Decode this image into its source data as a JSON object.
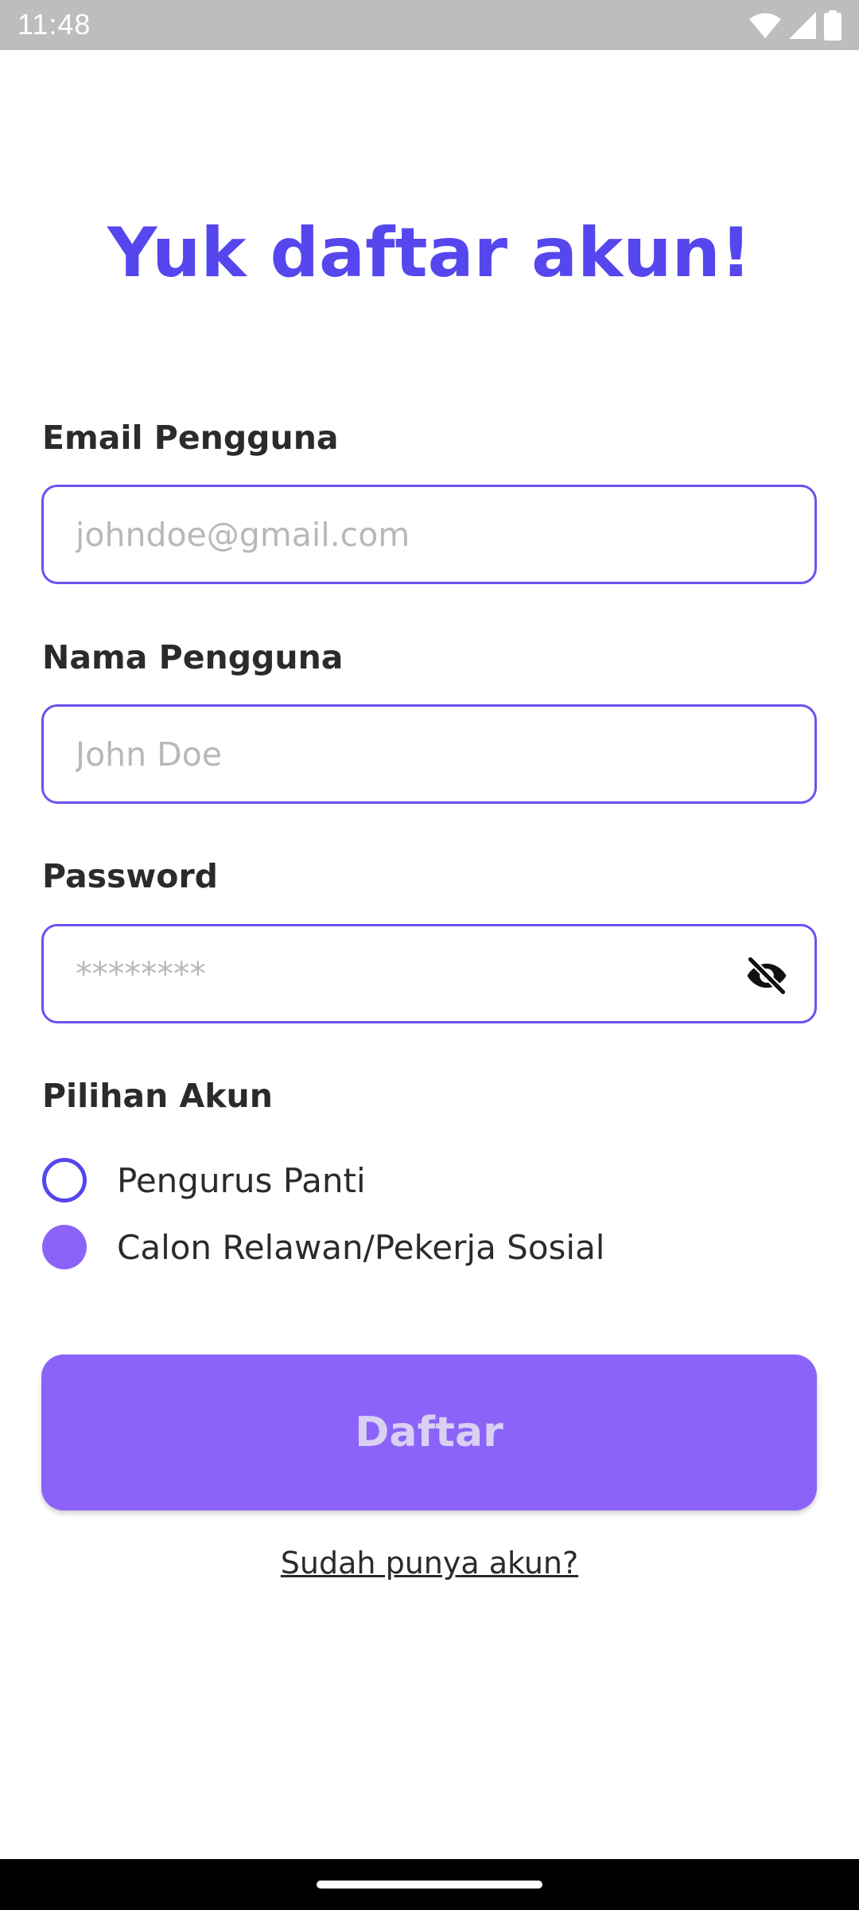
{
  "status_bar": {
    "time": "11:48",
    "icons": [
      "wifi-icon",
      "signal-icon",
      "battery-icon"
    ]
  },
  "title": "Yuk daftar akun!",
  "form": {
    "email": {
      "label": "Email Pengguna",
      "placeholder": "johndoe@gmail.com",
      "value": ""
    },
    "name": {
      "label": "Nama Pengguna",
      "placeholder": "John Doe",
      "value": ""
    },
    "password": {
      "label": "Password",
      "placeholder": "********",
      "value": "",
      "visibility_icon": "eye-off-icon"
    },
    "account_type": {
      "label": "Pilihan Akun",
      "options": [
        {
          "label": "Pengurus Panti",
          "selected": false
        },
        {
          "label": "Calon Relawan/Pekerja Sosial",
          "selected": true
        }
      ]
    },
    "submit_label": "Daftar",
    "login_link": "Sudah punya akun?"
  },
  "colors": {
    "primary": "#5546ee",
    "button": "#8b63f8",
    "button_text": "#d9d0f3",
    "border": "#6a53ee",
    "text": "#2b2b2b",
    "placeholder": "#b8b8b8",
    "status_bar": "#bdbdbd"
  }
}
